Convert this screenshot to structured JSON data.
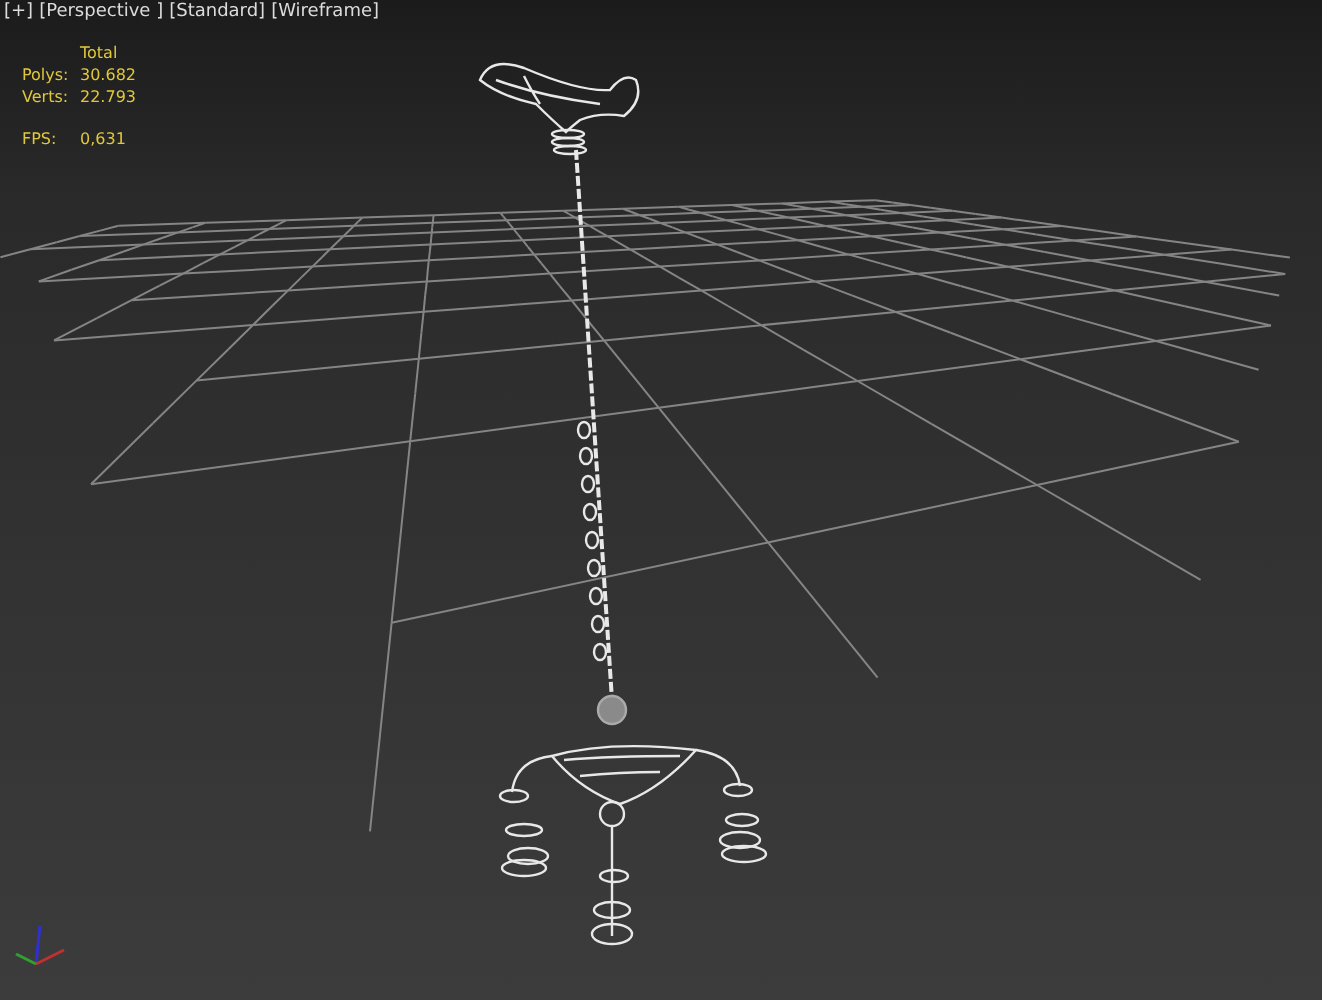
{
  "viewport": {
    "labels": [
      "[+]",
      "[Perspective ]",
      "[Standard]",
      "[Wireframe]"
    ],
    "stats": {
      "header": "Total",
      "rows": [
        {
          "label": "Polys:",
          "value": "30.682"
        },
        {
          "label": "Verts:",
          "value": "22.793"
        }
      ],
      "fps": {
        "label": "FPS:",
        "value": "0,631"
      }
    }
  }
}
